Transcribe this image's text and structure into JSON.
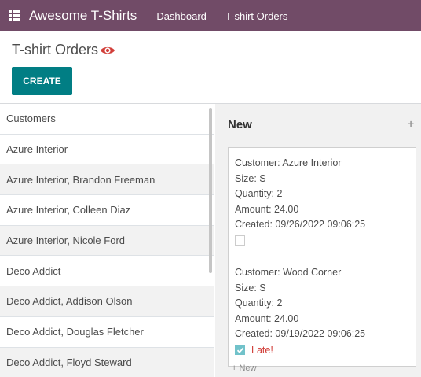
{
  "navbar": {
    "app_name": "Awesome T-Shirts",
    "menu": [
      "Dashboard",
      "T-shirt Orders"
    ]
  },
  "control": {
    "title": "T-shirt Orders",
    "create_label": "CREATE"
  },
  "searchpanel": {
    "header": "Customers",
    "items": [
      "Azure Interior",
      "Azure Interior, Brandon Freeman",
      "Azure Interior, Colleen Diaz",
      "Azure Interior, Nicole Ford",
      "Deco Addict",
      "Deco Addict, Addison Olson",
      "Deco Addict, Douglas Fletcher",
      "Deco Addict, Floyd Steward"
    ]
  },
  "kanban": {
    "column_title": "New",
    "add_symbol": "+",
    "quick_create": "+ New",
    "cards": [
      {
        "customer": "Customer: Azure Interior",
        "size": "Size: S",
        "quantity": "Quantity: 2",
        "amount": "Amount: 24.00",
        "created": "Created: 09/26/2022 09:06:25",
        "late_checked": false,
        "late_label": ""
      },
      {
        "customer": "Customer: Wood Corner",
        "size": "Size: S",
        "quantity": "Quantity: 2",
        "amount": "Amount: 24.00",
        "created": "Created: 09/19/2022 09:06:25",
        "late_checked": true,
        "late_label": "Late!"
      }
    ]
  },
  "colors": {
    "navbar": "#714b67",
    "primary_button": "#017e84",
    "late": "#d23f3a",
    "eye_icon": "#d23f3a",
    "checkbox_checked": "#71c2ca"
  },
  "icons": {
    "apps": "apps-grid-icon",
    "title_eye": "eye-icon",
    "checkmark": "checkmark-icon"
  }
}
